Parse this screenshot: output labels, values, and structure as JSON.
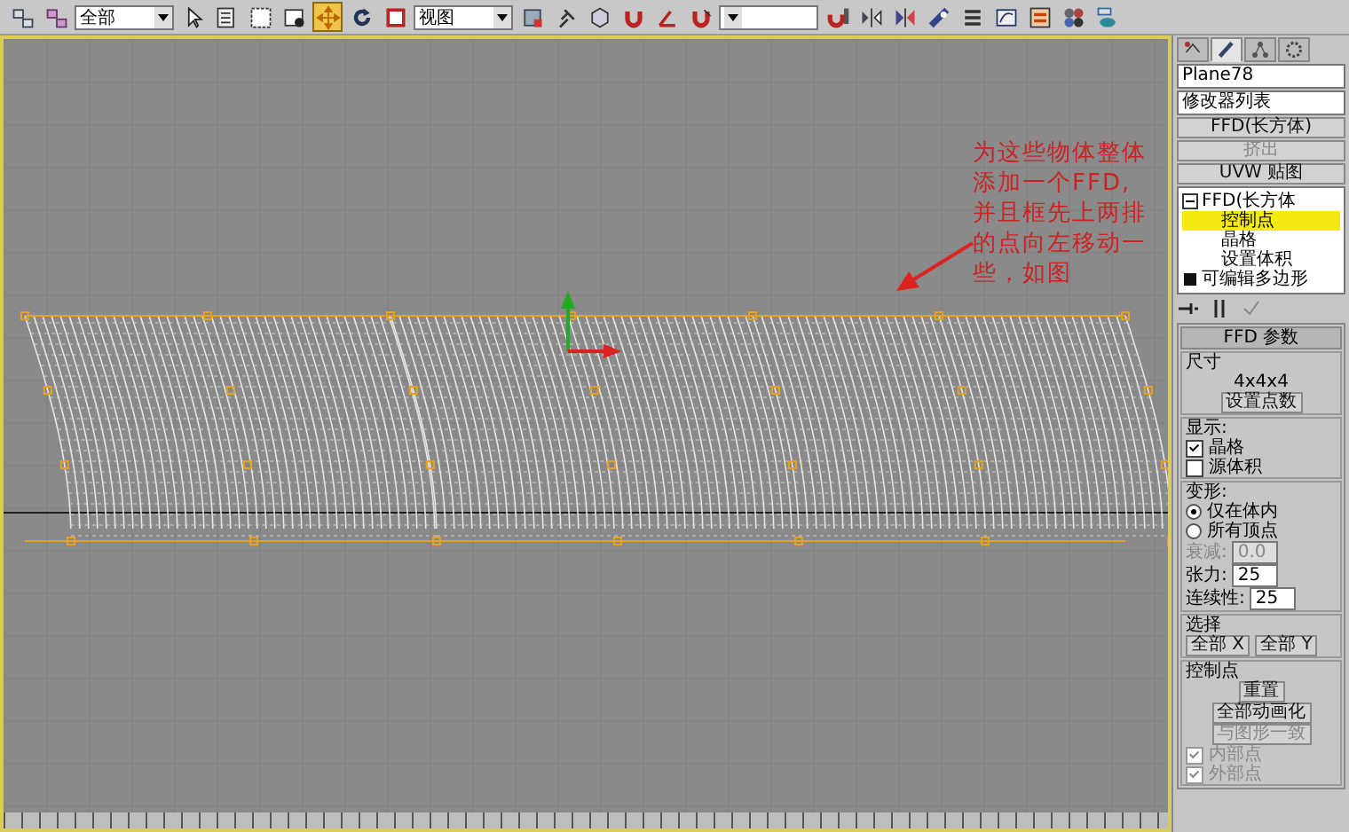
{
  "toolbar": {
    "items": [
      {
        "kind": "tool",
        "selected": false
      },
      {
        "kind": "tool",
        "selected": false
      },
      {
        "kind": "dropdown",
        "value": "全部"
      },
      {
        "kind": "tool",
        "selected": false
      },
      {
        "kind": "tool",
        "selected": false
      },
      {
        "kind": "tool",
        "selected": false
      },
      {
        "kind": "tool",
        "selected": false
      },
      {
        "kind": "tool",
        "selected": true
      },
      {
        "kind": "tool",
        "selected": false
      },
      {
        "kind": "tool",
        "selected": false
      },
      {
        "kind": "dropdown",
        "value": "视图"
      },
      {
        "kind": "tool",
        "selected": false
      },
      {
        "kind": "tool",
        "selected": false
      },
      {
        "kind": "tool",
        "selected": false
      },
      {
        "kind": "tool",
        "selected": false
      },
      {
        "kind": "tool",
        "selected": false
      },
      {
        "kind": "tool",
        "selected": false
      },
      {
        "kind": "dropdown"
      },
      {
        "kind": "tool",
        "selected": false
      },
      {
        "kind": "tool",
        "selected": false
      },
      {
        "kind": "tool",
        "selected": false
      },
      {
        "kind": "tool",
        "selected": false
      },
      {
        "kind": "tool",
        "selected": false
      },
      {
        "kind": "tool",
        "selected": false
      },
      {
        "kind": "tool",
        "selected": false
      },
      {
        "kind": "tool",
        "selected": false
      },
      {
        "kind": "tool",
        "selected": false
      }
    ]
  },
  "viewport": {
    "active": true,
    "annotation": "为这些物体整体添加一个FFD,并且框先上两排的点向左移动一些，如图"
  },
  "command_panel": {
    "tabs": [
      {
        "selected": false
      },
      {
        "selected": true
      },
      {
        "selected": false
      },
      {
        "selected": false
      }
    ],
    "object_name": "Plane78",
    "modifier_list": "修改器列表",
    "modifier_buttons": [
      {
        "label": "FFD(长方体)",
        "disabled": false
      },
      {
        "label": "挤出",
        "disabled": true
      },
      {
        "label": "UVW 贴图",
        "disabled": false
      }
    ],
    "stack": [
      {
        "label": "FFD(长方体",
        "expanded": true,
        "children": [
          {
            "label": "控制点",
            "selected": true
          },
          {
            "label": "晶格",
            "selected": false
          },
          {
            "label": "设置体积",
            "selected": false
          }
        ]
      },
      {
        "label": "可编辑多边形",
        "expanded": false
      }
    ],
    "rollout": {
      "title": "FFD 参数",
      "sections": [
        {
          "title": "尺寸",
          "rows": [
            {
              "kind": "text",
              "text": "4x4x4"
            },
            {
              "kind": "button",
              "label": "设置点数",
              "disabled": false
            }
          ]
        },
        {
          "title": "显示:",
          "rows": [
            {
              "kind": "checkbox",
              "label": "晶格",
              "checked": true,
              "disabled": false
            },
            {
              "kind": "checkbox",
              "label": "源体积",
              "checked": false,
              "disabled": false
            }
          ]
        },
        {
          "title": "变形:",
          "rows": [
            {
              "kind": "radio",
              "label": "仅在体内",
              "selected": true
            },
            {
              "kind": "radio",
              "label": "所有顶点",
              "selected": false
            },
            {
              "kind": "spinner",
              "label": "衰减:",
              "value": "0.0",
              "disabled": true
            },
            {
              "kind": "spinner",
              "label": "张力:",
              "value": "25",
              "disabled": false
            },
            {
              "kind": "spinner",
              "label": "连续性:",
              "value": "25",
              "disabled": false
            }
          ]
        },
        {
          "title": "选择",
          "rows": [
            {
              "kind": "buttons",
              "labels": [
                "全部 X",
                "全部 Y"
              ]
            }
          ]
        },
        {
          "title": "控制点",
          "rows": [
            {
              "kind": "button",
              "label": "重置",
              "disabled": false
            },
            {
              "kind": "button",
              "label": "全部动画化",
              "disabled": false
            },
            {
              "kind": "button",
              "label": "与图形一致",
              "disabled": true
            },
            {
              "kind": "checkbox",
              "label": "内部点",
              "checked": true,
              "disabled": true
            },
            {
              "kind": "checkbox",
              "label": "外部点",
              "checked": true,
              "disabled": true
            }
          ]
        }
      ]
    }
  }
}
